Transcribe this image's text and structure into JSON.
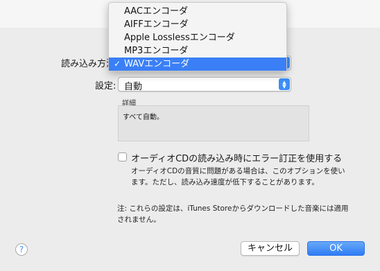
{
  "import_row": {
    "label": "読み込み方法",
    "selected": "WAVエンコーダ"
  },
  "setting_row": {
    "label": "設定:",
    "value": "自動"
  },
  "details": {
    "label": "詳細",
    "text": "すべて自動。"
  },
  "error_correction": {
    "label": "オーディオCDの読み込み時にエラー訂正を使用する",
    "desc_line1": "オーディオCDの音質に問題がある場合は、このオプションを使い",
    "desc_line2": "ます。ただし、読み込み速度が低下することがあります。",
    "checked": false
  },
  "note": {
    "line1": "注: これらの設定は、iTunes Storeからダウンロードした音楽には適用",
    "line2": "されません。"
  },
  "buttons": {
    "help": "?",
    "cancel": "キャンセル",
    "ok": "OK"
  },
  "menu": {
    "items": [
      {
        "label": "AACエンコーダ",
        "checked": false
      },
      {
        "label": "AIFFエンコーダ",
        "checked": false
      },
      {
        "label": "Apple Losslessエンコーダ",
        "checked": false
      },
      {
        "label": "MP3エンコーダ",
        "checked": false
      },
      {
        "label": "WAVエンコーダ",
        "checked": true
      }
    ],
    "check_glyph": "✓"
  },
  "colors": {
    "accent": "#3a7ff6",
    "dialog_bg": "#ececec"
  }
}
